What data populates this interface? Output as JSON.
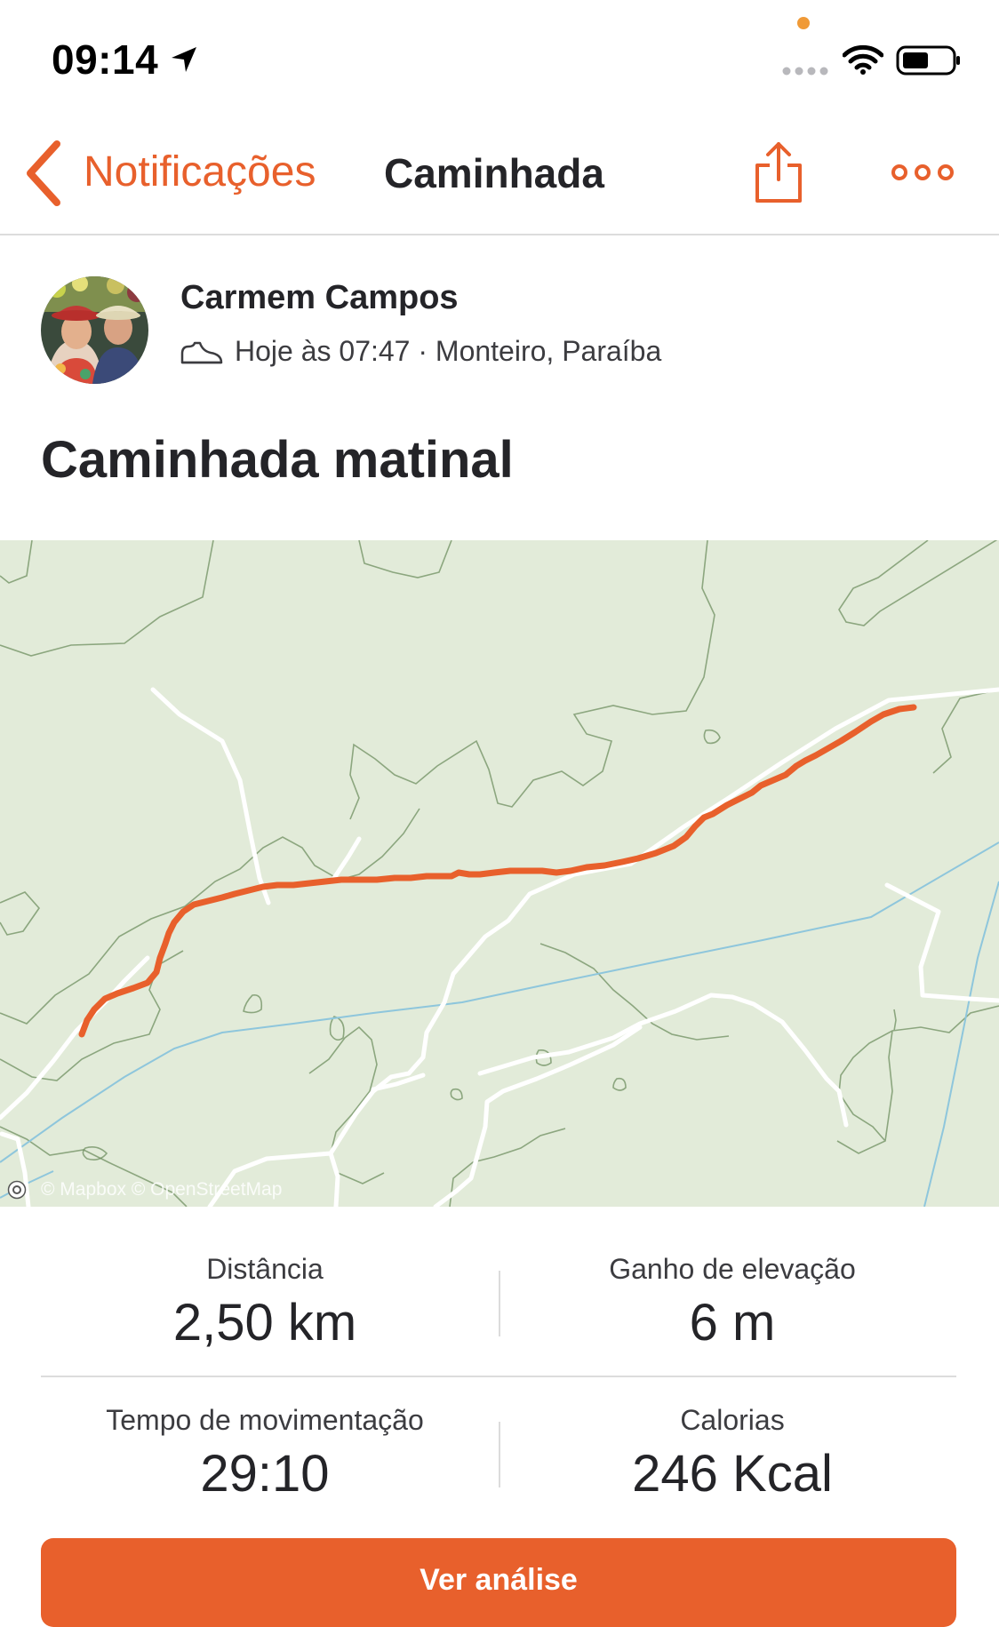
{
  "status_bar": {
    "time": "09:14",
    "mic_indicator_color": "#f09a37"
  },
  "nav": {
    "back_label": "Notificações",
    "title": "Caminhada"
  },
  "activity": {
    "athlete_name": "Carmem Campos",
    "meta": "Hoje às 07:47 · Monteiro, Paraíba",
    "title": "Caminhada matinal"
  },
  "map": {
    "attribution": "© Mapbox © OpenStreetMap",
    "route_color": "#e8602c"
  },
  "stats": [
    {
      "label": "Distância",
      "value": "2,50 km"
    },
    {
      "label": "Ganho de elevação",
      "value": "6 m"
    },
    {
      "label": "Tempo de movimentação",
      "value": "29:10"
    },
    {
      "label": "Calorias",
      "value": "246 Kcal"
    }
  ],
  "button": {
    "label": "Ver análise"
  },
  "colors": {
    "accent": "#e8602c",
    "map_background": "#e2ebd9",
    "contour": "#6f8f60",
    "water": "#8ec6dc",
    "road": "#ffffff"
  },
  "icons": [
    "location-arrow-icon",
    "wifi-icon",
    "battery-icon",
    "back-chevron-icon",
    "share-icon",
    "more-icon",
    "shoe-icon",
    "mapbox-logo-icon"
  ]
}
